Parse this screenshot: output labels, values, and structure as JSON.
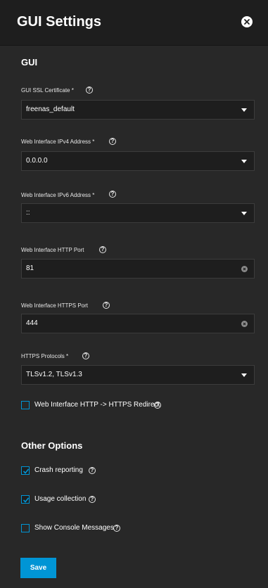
{
  "header": {
    "title": "GUI Settings"
  },
  "sections": {
    "gui": "GUI",
    "other": "Other Options"
  },
  "fields": {
    "ssl_cert": {
      "label": "GUI SSL Certificate *",
      "value": "freenas_default"
    },
    "ipv4": {
      "label": "Web Interface IPv4 Address *",
      "value": "0.0.0.0"
    },
    "ipv6": {
      "label": "Web Interface IPv6 Address *",
      "value": "::"
    },
    "http_port": {
      "label": "Web Interface HTTP Port",
      "value": "81"
    },
    "https_port": {
      "label": "Web Interface HTTPS Port",
      "value": "444"
    },
    "https_protocols": {
      "label": "HTTPS Protocols *",
      "value": "TLSv1.2, TLSv1.3"
    }
  },
  "checkboxes": {
    "redirect": {
      "label": "Web Interface HTTP -> HTTPS Redirect",
      "checked": false
    },
    "crash": {
      "label": "Crash reporting",
      "checked": true
    },
    "usage": {
      "label": "Usage collection",
      "checked": true
    },
    "console": {
      "label": "Show Console Messages",
      "checked": false
    }
  },
  "help_glyph": "?",
  "actions": {
    "save": "Save"
  },
  "colors": {
    "accent": "#0095d5",
    "background": "#282828",
    "header": "#1e1e1e"
  }
}
